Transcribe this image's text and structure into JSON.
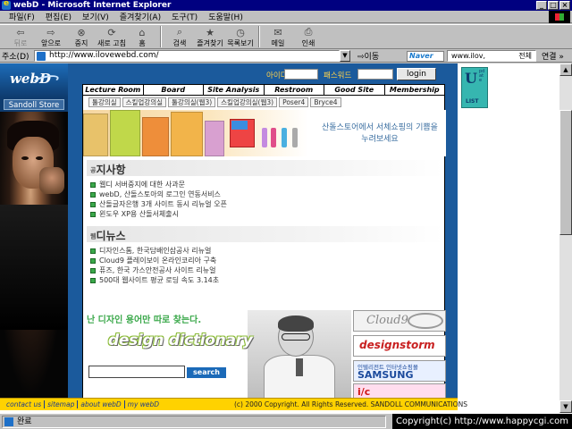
{
  "window": {
    "title": "webD - Microsoft Internet Explorer"
  },
  "menu": [
    "파일(F)",
    "편집(E)",
    "보기(V)",
    "즐겨찾기(A)",
    "도구(T)",
    "도움말(H)"
  ],
  "toolbar": {
    "back": "뒤로",
    "forward": "앞으로",
    "stop": "중지",
    "refresh": "새로 고침",
    "home": "홈",
    "search": "검색",
    "favorites": "즐겨찾기",
    "history": "목록보기",
    "mail": "메일",
    "print": "인쇄"
  },
  "address": {
    "label": "주소(D)",
    "url": "http://www.ilovewebd.com/",
    "go": "이동",
    "search_brand": "Naver",
    "links_value": "www.ilov,",
    "links_all": "전체",
    "links_label": "연결 »"
  },
  "site": {
    "logo": "webD",
    "store": "Sandoll Store",
    "login": {
      "id_label": "아이디",
      "pw_label": "패스워드",
      "button": "login"
    },
    "nav": [
      "Lecture Room",
      "Board",
      "Site Analysis",
      "Restroom",
      "Good Site",
      "Membership"
    ],
    "subnav": [
      "툴강의실",
      "스킬업강의실",
      "툴강의실(웹3)",
      "스킬업강의실(웹3)",
      "Poser4",
      "Bryce4"
    ],
    "banner_text": "산돌스토어에서 서체쇼핑의 기쁨을 누려보세요",
    "notice": {
      "title_prefix": "공",
      "title": "지사항",
      "items": [
        "웹디 서버중지에 대한 사과문",
        "webD, 산돌스토아의 로그인 연동서비스",
        "산돌글자은행 3개 사이트 동시 리뉴얼 오픈",
        "윈도우 XP용 산돌서체출시"
      ]
    },
    "webnews": {
      "title_prefix": "웹",
      "title": "디뉴스",
      "items": [
        "디자인스톰, 한국담배인삼공사 리뉴얼",
        "Cloud9 플레이보이 온라인코리아 구축",
        "퓨즈, 한국 가스안전공사 사이트 리뉴얼",
        "500대 웹사이트 평균 로딩 속도 3.14초"
      ]
    },
    "dictionary": {
      "tagline": "난 디자인 용어만 따로 찾는다.",
      "title": "design dictionary",
      "search_button": "search"
    },
    "ads": {
      "cloud9": "Cloud9",
      "designstorm": "designstorm",
      "samsung_small": "인텔리전트 인터넷쇼핑몰",
      "samsung": "SAMSUNG MALL",
      "fourth": "i/c"
    },
    "footer": {
      "links": [
        "contact us",
        "sitemap",
        "about webD",
        "my webD"
      ],
      "copyright": "(c) 2000 Copyright.  All Rights Reserved.  SANDOLL COMMUNICATIONS"
    },
    "update_widget": {
      "letter": "U",
      "small": "pdate",
      "list": "LIST"
    }
  },
  "status": {
    "text": "완료"
  },
  "overlay": {
    "copyright": "Copyright(c) http://www.happycgi.com"
  }
}
